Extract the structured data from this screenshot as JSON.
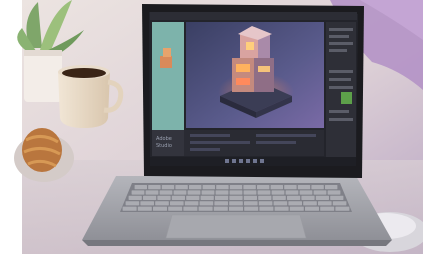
{
  "photo": {
    "app_label_line1": "Adobe",
    "app_label_line2": "Studio"
  }
}
